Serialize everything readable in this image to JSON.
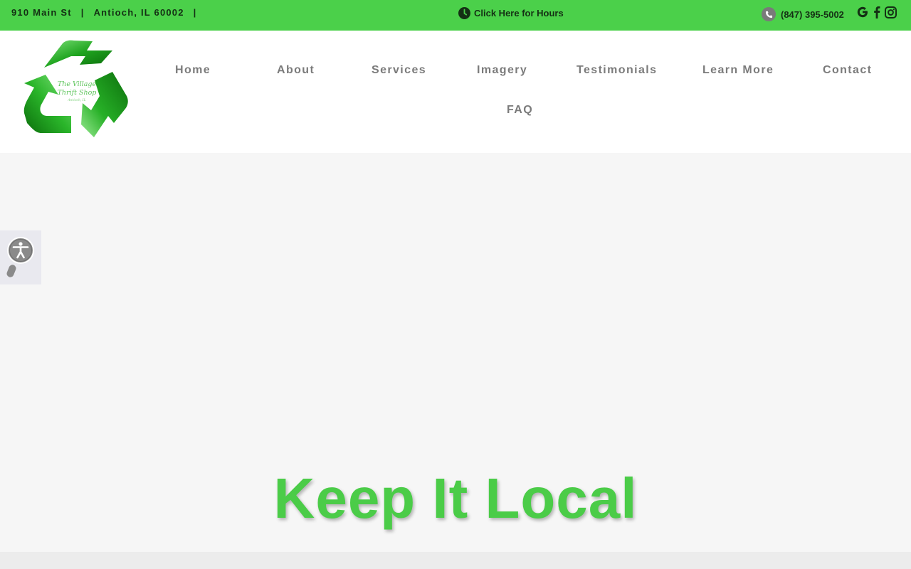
{
  "topbar": {
    "street": "910 Main St",
    "city": "Antioch, IL 60002",
    "separator": "|",
    "hours_label": "Click Here for Hours",
    "phone": "(847) 395-5002",
    "social_icons": [
      "google-icon",
      "facebook-icon",
      "instagram-icon"
    ]
  },
  "logo": {
    "line1": "The Village",
    "line2": "Thrift Shop",
    "line3": "Antioch, IL"
  },
  "nav": {
    "items": [
      {
        "label": "Home"
      },
      {
        "label": "About"
      },
      {
        "label": "Services"
      },
      {
        "label": "Imagery"
      },
      {
        "label": "Testimonials"
      },
      {
        "label": "Learn More"
      },
      {
        "label": "Contact"
      },
      {
        "label": "FAQ"
      }
    ]
  },
  "hero": {
    "title": "Keep It Local"
  },
  "colors": {
    "brand_green": "#4bd04a",
    "nav_text": "#7b7b7b",
    "hero_bg": "#f6f6f6"
  },
  "widgets": {
    "accessibility_icon": "accessibility-icon"
  }
}
